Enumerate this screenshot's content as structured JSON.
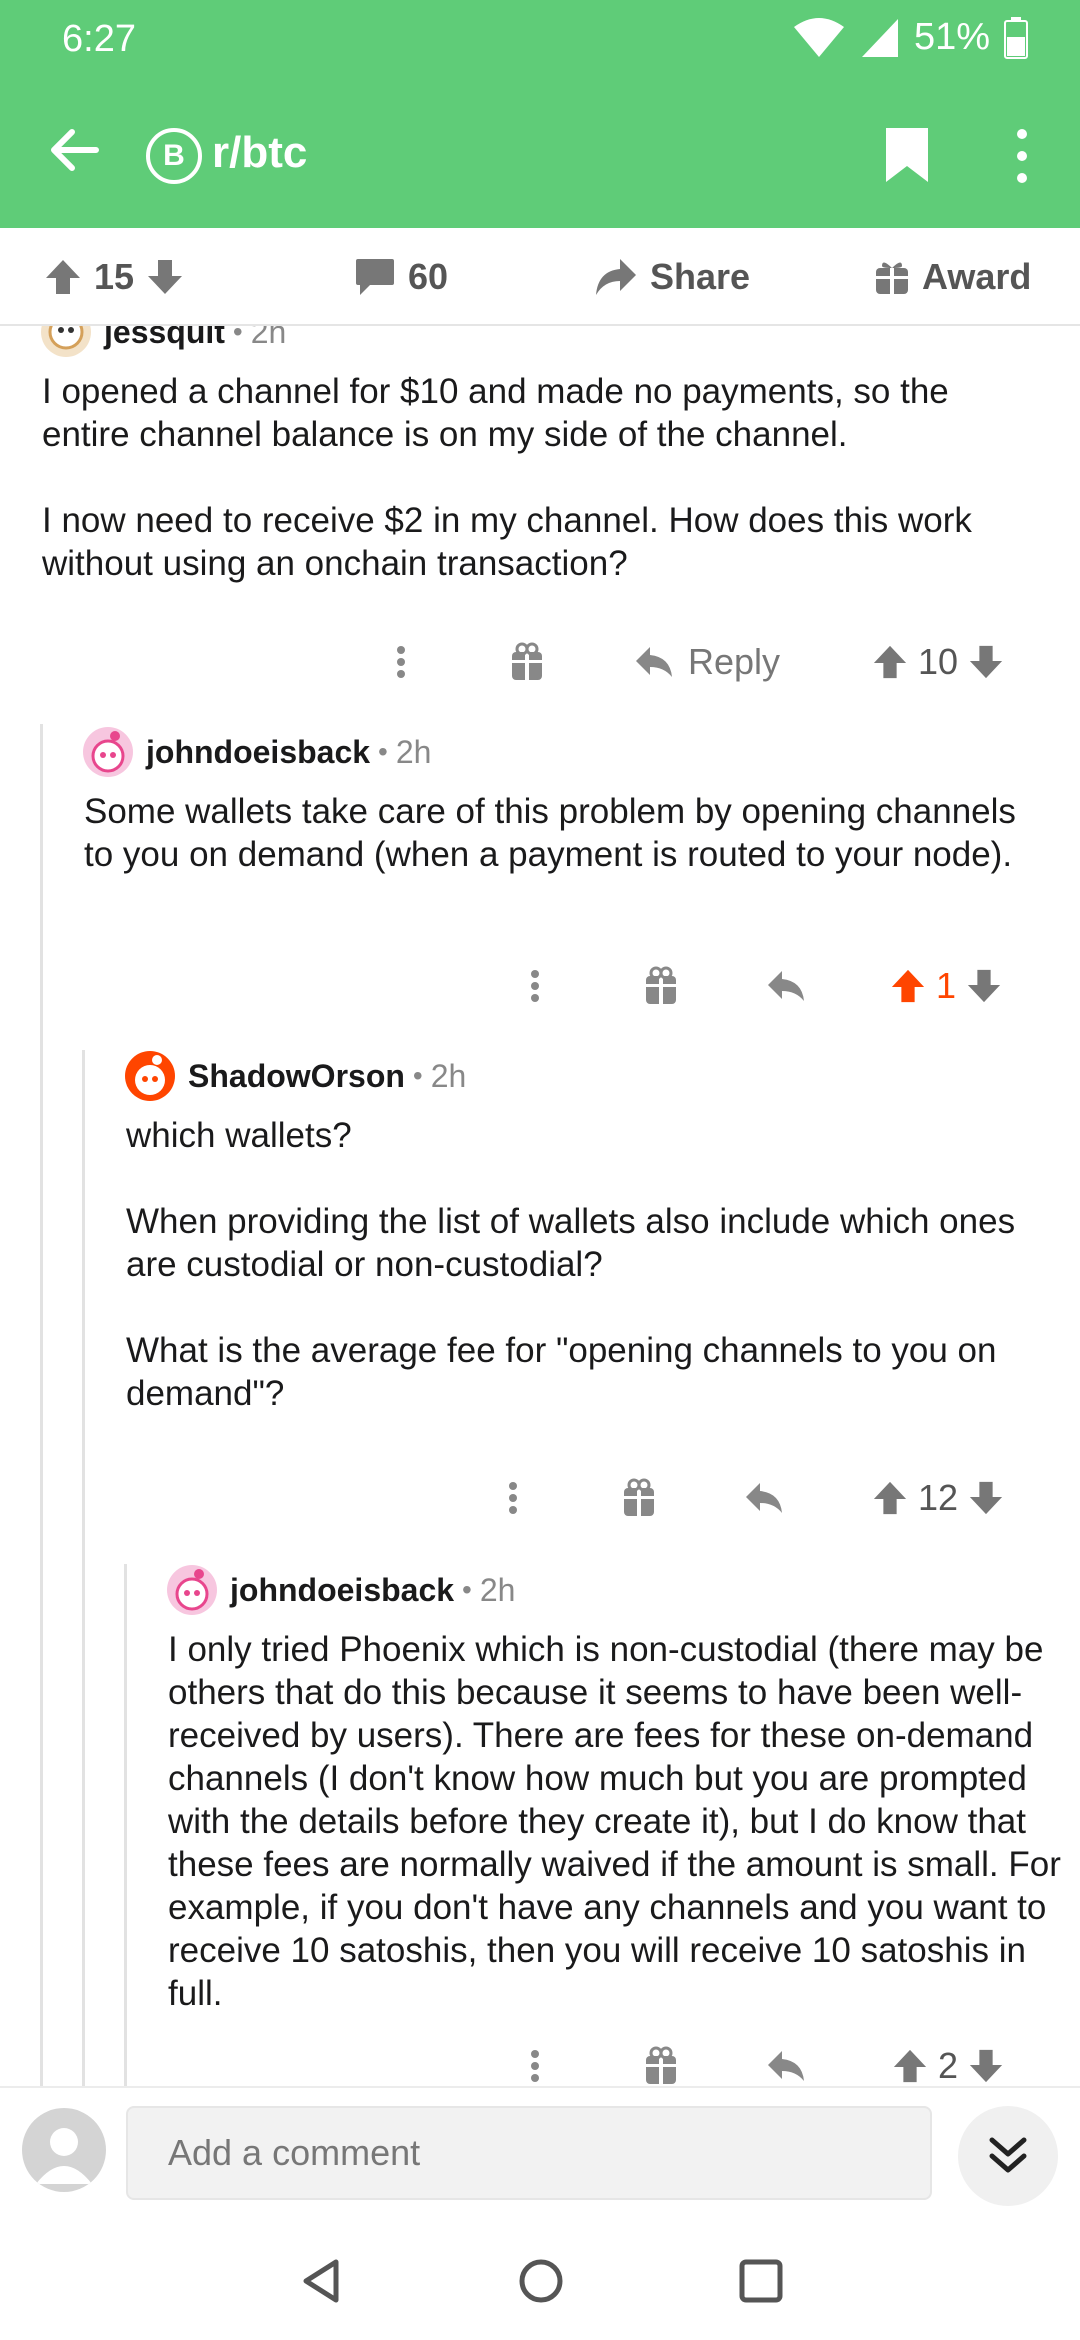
{
  "status_bar": {
    "time": "6:27",
    "battery": "51%"
  },
  "header": {
    "subreddit": "r/btc",
    "subreddit_icon_glyph": "B",
    "accent": "#5fcc78"
  },
  "post_bar": {
    "votes": "15",
    "comments": "60",
    "share_label": "Share",
    "award_label": "Award"
  },
  "comments": [
    {
      "author": "jessquit",
      "time": "2h",
      "paragraphs": [
        "I opened a channel for $10 and made no payments, so the entire channel balance is on my side of the channel.",
        "I now need to receive $2 in my channel.  How does this work without using an onchain transaction?"
      ],
      "reply_label": "Reply",
      "votes": "10"
    },
    {
      "author": "johndoeisback",
      "time": "2h",
      "paragraphs": [
        "Some wallets take care of this problem by opening channels to you on demand (when a payment is routed to your node)."
      ],
      "votes": "1",
      "upvoted_color": "#ff4500"
    },
    {
      "author": "ShadowOrson",
      "time": "2h",
      "paragraphs": [
        "which wallets?",
        "When providing the list of wallets also include which ones are custodial or non-custodial?",
        "What is the average fee for \"opening channels to you on demand\"?"
      ],
      "votes": "12"
    },
    {
      "author": "johndoeisback",
      "time": "2h",
      "paragraphs": [
        "I only tried Phoenix which is non-custodial (there may be others that do this because it seems to have been well-received by users). There are fees for these on-demand channels (I don't know how much but you are prompted with the details before they create it), but I do know that these fees are normally waived if the amount is small. For example, if you don't have any channels and you want to receive 10 satoshis, then you will receive 10 satoshis in full."
      ],
      "votes": "2"
    }
  ],
  "composer": {
    "placeholder": "Add a comment"
  }
}
